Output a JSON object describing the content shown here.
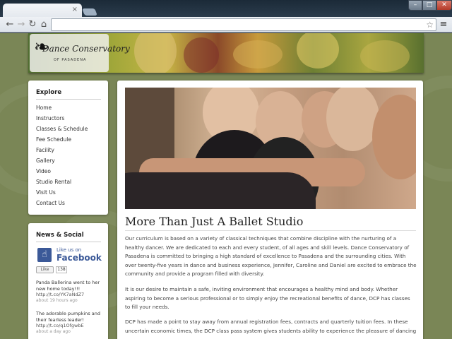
{
  "browser": {
    "tab_close": "×",
    "window_controls": {
      "minimize": "–",
      "maximize": "□",
      "close": "✕"
    },
    "icons": [
      "back-arrow-icon",
      "forward-arrow-icon",
      "reload-icon",
      "home-icon",
      "star-icon",
      "wrench-menu-icon"
    ],
    "address_value": ""
  },
  "banner": {
    "logo_text": "Dance Conservatory",
    "logo_sub": "OF PASADENA"
  },
  "sidebar": {
    "explore_title": "Explore",
    "nav_items": [
      {
        "label": "Home"
      },
      {
        "label": "Instructors"
      },
      {
        "label": "Classes & Schedule"
      },
      {
        "label": "Fee Schedule"
      },
      {
        "label": "Facility"
      },
      {
        "label": "Gallery"
      },
      {
        "label": "Video"
      },
      {
        "label": "Studio Rental"
      },
      {
        "label": "Visit Us"
      },
      {
        "label": "Contact Us"
      }
    ],
    "news_title": "News & Social",
    "facebook": {
      "like_us_on": "Like us on",
      "facebook": "Facebook",
      "like_button": "Like",
      "like_count": "138"
    },
    "tweets": [
      {
        "text": "Panda Ballerina went to her new home today!!!",
        "link": "http://t.co/YK7aNdZ7",
        "time": "about 19 hours ago"
      },
      {
        "text": "The adorable pumpkins and their fearless leader!",
        "link": "http://t.co/q1OfgwbE",
        "time": "about a day ago"
      }
    ]
  },
  "main": {
    "title": "More Than Just A Ballet Studio",
    "paragraphs": [
      "Our curriculum is based on a variety of classical techniques that combine discipline with the nurturing of a healthy dancer. We are dedicated to each and every student, of all ages and skill levels. Dance Conservatory of Pasadena is committed to bringing a high standard of excellence to Pasadena and the surrounding cities. With over twenty-five years in dance and business experience, Jennifer, Caroline and Daniel are excited to embrace the community and provide a program filled with diversity.",
      "It is our desire to maintain a safe, inviting environment that encourages a healthy mind and body. Whether aspiring to become a serious professional or to simply enjoy the recreational benefits of dance, DCP has classes to fill your needs.",
      "DCP has made a point to stay away from annual registration fees, contracts and quarterly tuition fees. In these uncertain economic times, the DCP class pass system gives students ability to experience the pleasure of dancing"
    ]
  },
  "colors": {
    "page_background": "#7a8656",
    "facebook_blue": "#3b5998"
  }
}
